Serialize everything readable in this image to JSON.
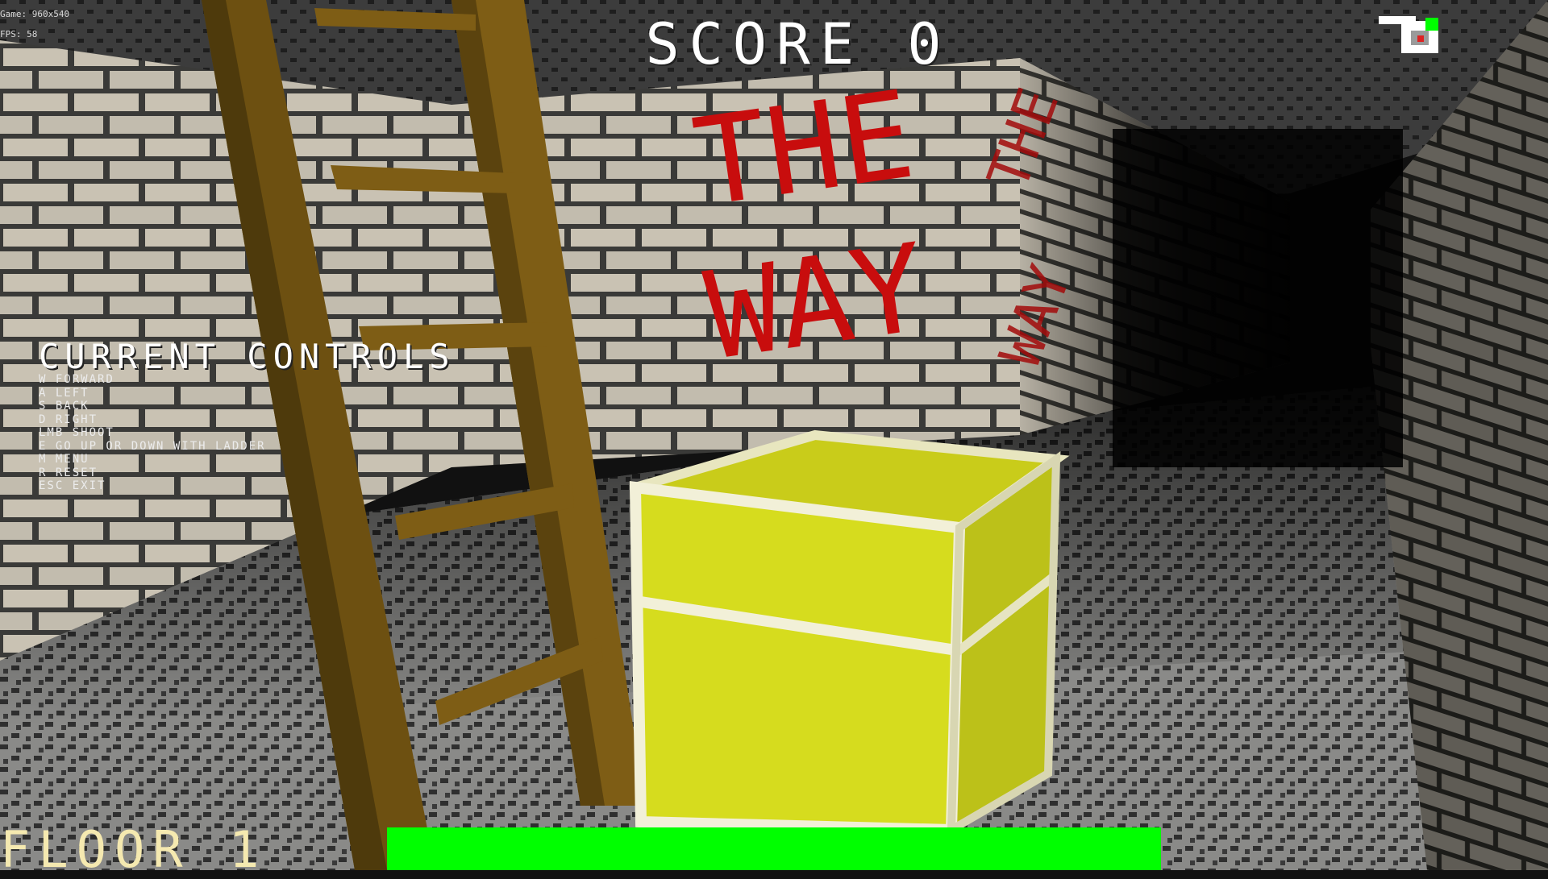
{
  "hud": {
    "score_text": "SCORE 0",
    "floor_text": "FLOOR 1",
    "debug": [
      "Game: 960x540",
      "FPS: 58"
    ],
    "controls_title": "CURRENT CONTROLS",
    "controls": [
      "W FORWARD",
      "A LEFT",
      "S BACK",
      "D RIGHT",
      "LMB SHOOT",
      "E GO UP OR DOWN WITH LADDER",
      "M MENU",
      "R RESET",
      "ESC EXIT"
    ],
    "health_fraction": 1.0,
    "health_color": "#00ff00"
  },
  "scene": {
    "graffiti_front": [
      "THE",
      "WAY"
    ],
    "graffiti_side": [
      "THE",
      "WAY"
    ],
    "colors": {
      "brick": "#c9c2b3",
      "mortar": "#3a3a38",
      "chest": "#d6dc1e",
      "chest_trim": "#f2f0d8",
      "ladder": "#7a5a14",
      "graffiti": "#c80d0d",
      "floor_tile": "#8d8d8d"
    }
  },
  "minimap": {
    "player_color": "#00ff00",
    "wall_color": "#ffffff"
  }
}
